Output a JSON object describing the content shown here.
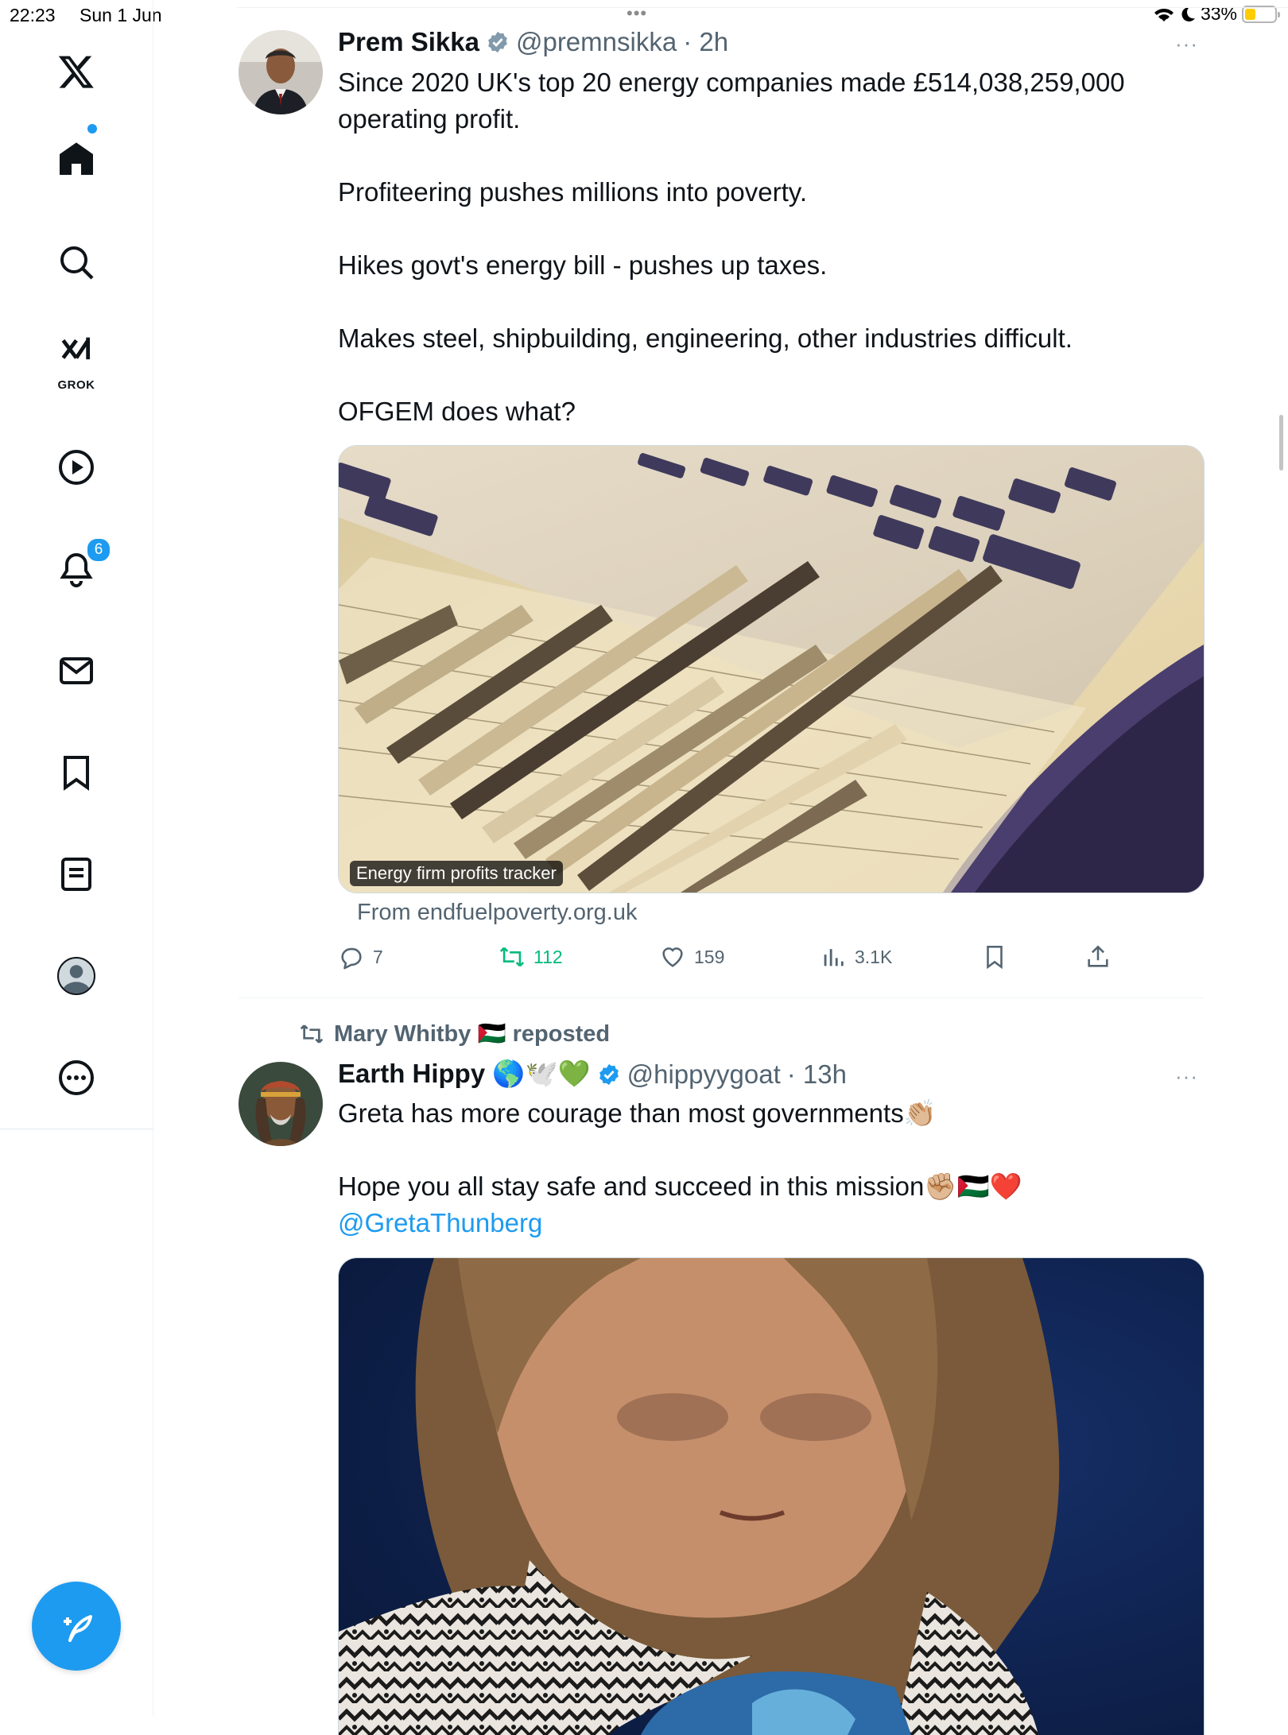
{
  "status_bar": {
    "time": "22:23",
    "date": "Sun 1 Jun",
    "battery": "33%",
    "dots": "•••"
  },
  "sidebar": {
    "items": [
      {
        "name": "x-logo"
      },
      {
        "name": "home"
      },
      {
        "name": "search"
      },
      {
        "name": "grok",
        "label": "GROK"
      },
      {
        "name": "videos"
      },
      {
        "name": "notifications",
        "badge": "6"
      },
      {
        "name": "messages"
      },
      {
        "name": "bookmarks"
      },
      {
        "name": "lists"
      },
      {
        "name": "profile"
      },
      {
        "name": "more"
      }
    ]
  },
  "tweets": [
    {
      "name": "Prem Sikka",
      "handle": "@premnsikka",
      "time": "· 2h",
      "more": "···",
      "text": "Since 2020 UK's top 20 energy companies made £514,038,259,000 operating profit.\n\nProfiteering pushes millions into poverty.\n\nHikes govt's energy bill - pushes up taxes.\n\nMakes steel, shipbuilding, engineering, other industries difficult.\n\nOFGEM does what?",
      "media_caption": "Energy firm profits tracker",
      "link_source": "From endfuelpoverty.org.uk",
      "stats": {
        "replies": "7",
        "reposts": "112",
        "likes": "159",
        "views": "3.1K"
      }
    },
    {
      "reposted_by": "Mary Whitby 🇵🇸 reposted",
      "name": "Earth Hippy 🌎🕊️💚",
      "handle": "@hippyygoat",
      "time": "· 13h",
      "more": "···",
      "text_line1": "Greta has more courage than most governments👏🏼",
      "text_line2": "Hope you all stay safe and succeed in this mission✊🏼🇵🇸❤️",
      "mention": "@GretaThunberg"
    }
  ],
  "colors": {
    "accent": "#1d9bf0",
    "repost_green": "#00ba7c",
    "text_secondary": "#536471"
  }
}
